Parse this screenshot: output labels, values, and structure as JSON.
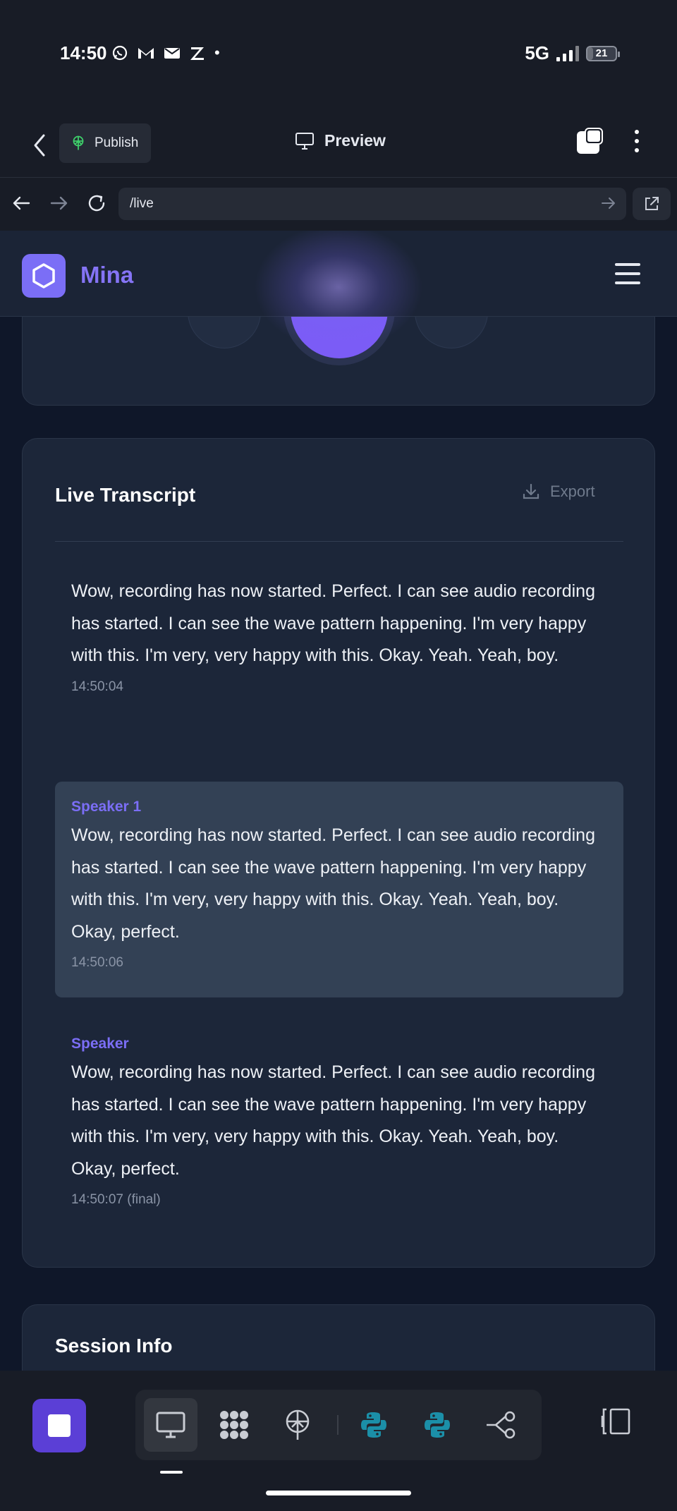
{
  "status_bar": {
    "time": "14:50",
    "network": "5G",
    "battery": "21",
    "battery_level_percent": 21,
    "notification_icons": [
      "whatsapp-icon",
      "gmail-icon",
      "mail-icon",
      "z-app-icon",
      "dot-icon"
    ]
  },
  "editor": {
    "publish_label": "Publish",
    "preview_label": "Preview"
  },
  "browser": {
    "url": "/live"
  },
  "app": {
    "brand": "Mina"
  },
  "transcript": {
    "title": "Live Transcript",
    "export_label": "Export",
    "entries": [
      {
        "speaker": "",
        "text": "Wow, recording has now started. Perfect. I can see audio recording has started. I can see the wave pattern happening. I'm very happy with this. I'm very, very happy with this. Okay. Yeah. Yeah, boy.",
        "time": "14:50:04"
      },
      {
        "speaker": "Speaker 1",
        "text": "Wow, recording has now started. Perfect. I can see audio recording has started. I can see the wave pattern happening. I'm very happy with this. I'm very, very happy with this. Okay. Yeah. Yeah, boy. Okay, perfect.",
        "time": "14:50:06"
      },
      {
        "speaker": "Speaker",
        "text": "Wow, recording has now started. Perfect. I can see audio recording has started. I can see the wave pattern happening. I'm very happy with this. I'm very, very happy with this. Okay. Yeah. Yeah, boy. Okay, perfect.",
        "time": "14:50:07 (final)"
      }
    ]
  },
  "session": {
    "title": "Session Info"
  },
  "toolbar": {
    "tools": [
      "desktop-icon",
      "apps-grid-icon",
      "deploy-icon",
      "python-icon",
      "python-icon",
      "graph-icon"
    ]
  },
  "colors": {
    "accent": "#7b6ef6",
    "record_button": "#7b5cf6",
    "background": "#0f1729",
    "card": "#1c2639",
    "highlight_row": "#334155"
  }
}
